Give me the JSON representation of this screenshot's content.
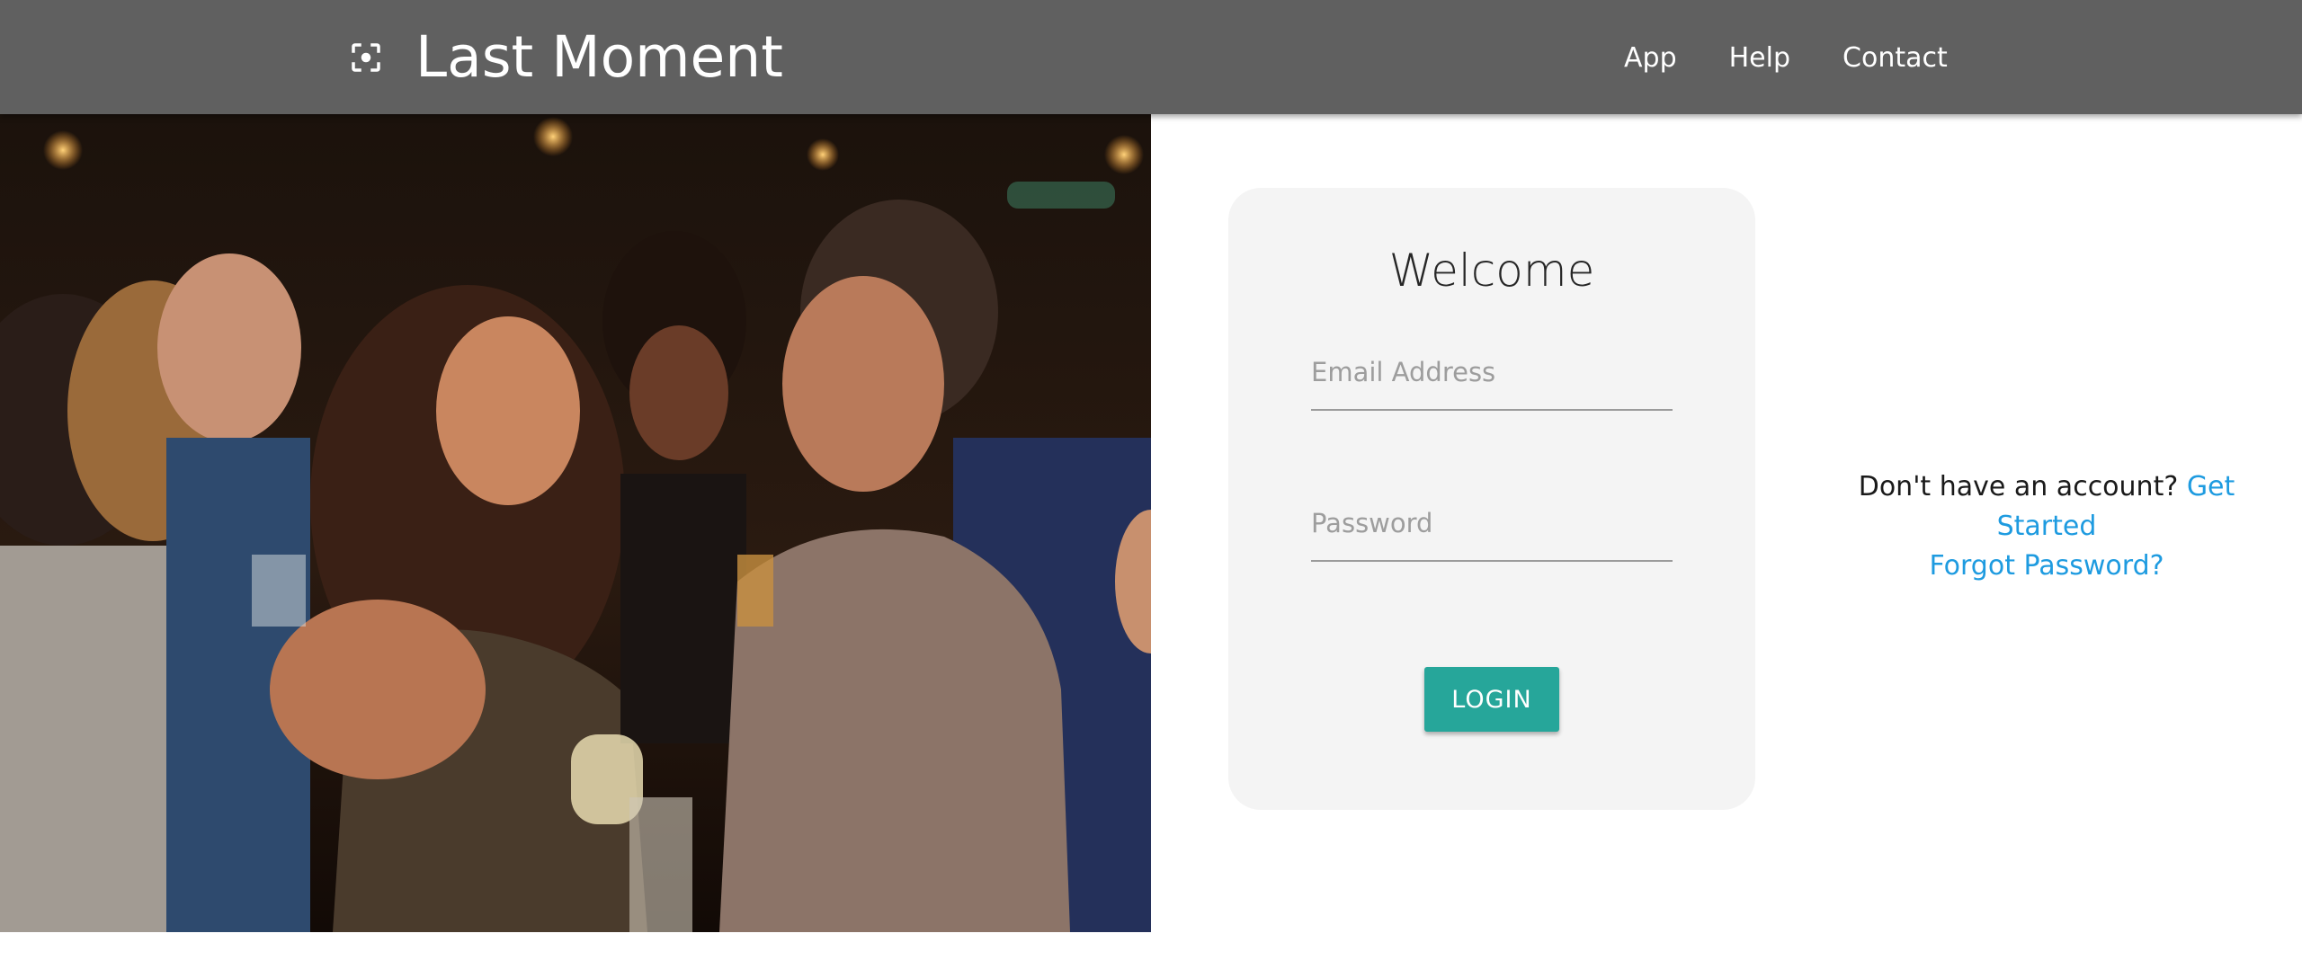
{
  "header": {
    "brand_title": "Last Moment",
    "brand_icon": "center-focus-icon",
    "nav": [
      {
        "label": "App"
      },
      {
        "label": "Help"
      },
      {
        "label": "Contact"
      }
    ],
    "background_color": "#606060"
  },
  "hero": {
    "image_icon": "party-photo"
  },
  "login_card": {
    "title": "Welcome",
    "email": {
      "placeholder": "Email Address",
      "value": ""
    },
    "password": {
      "placeholder": "Password",
      "value": ""
    },
    "login_label": "LOGIN",
    "login_color": "#26a69a"
  },
  "side": {
    "no_account_text": "Don't have an account?",
    "get_started_label": "Get Started",
    "forgot_password_label": "Forgot Password?",
    "link_color": "#1e9be0"
  }
}
